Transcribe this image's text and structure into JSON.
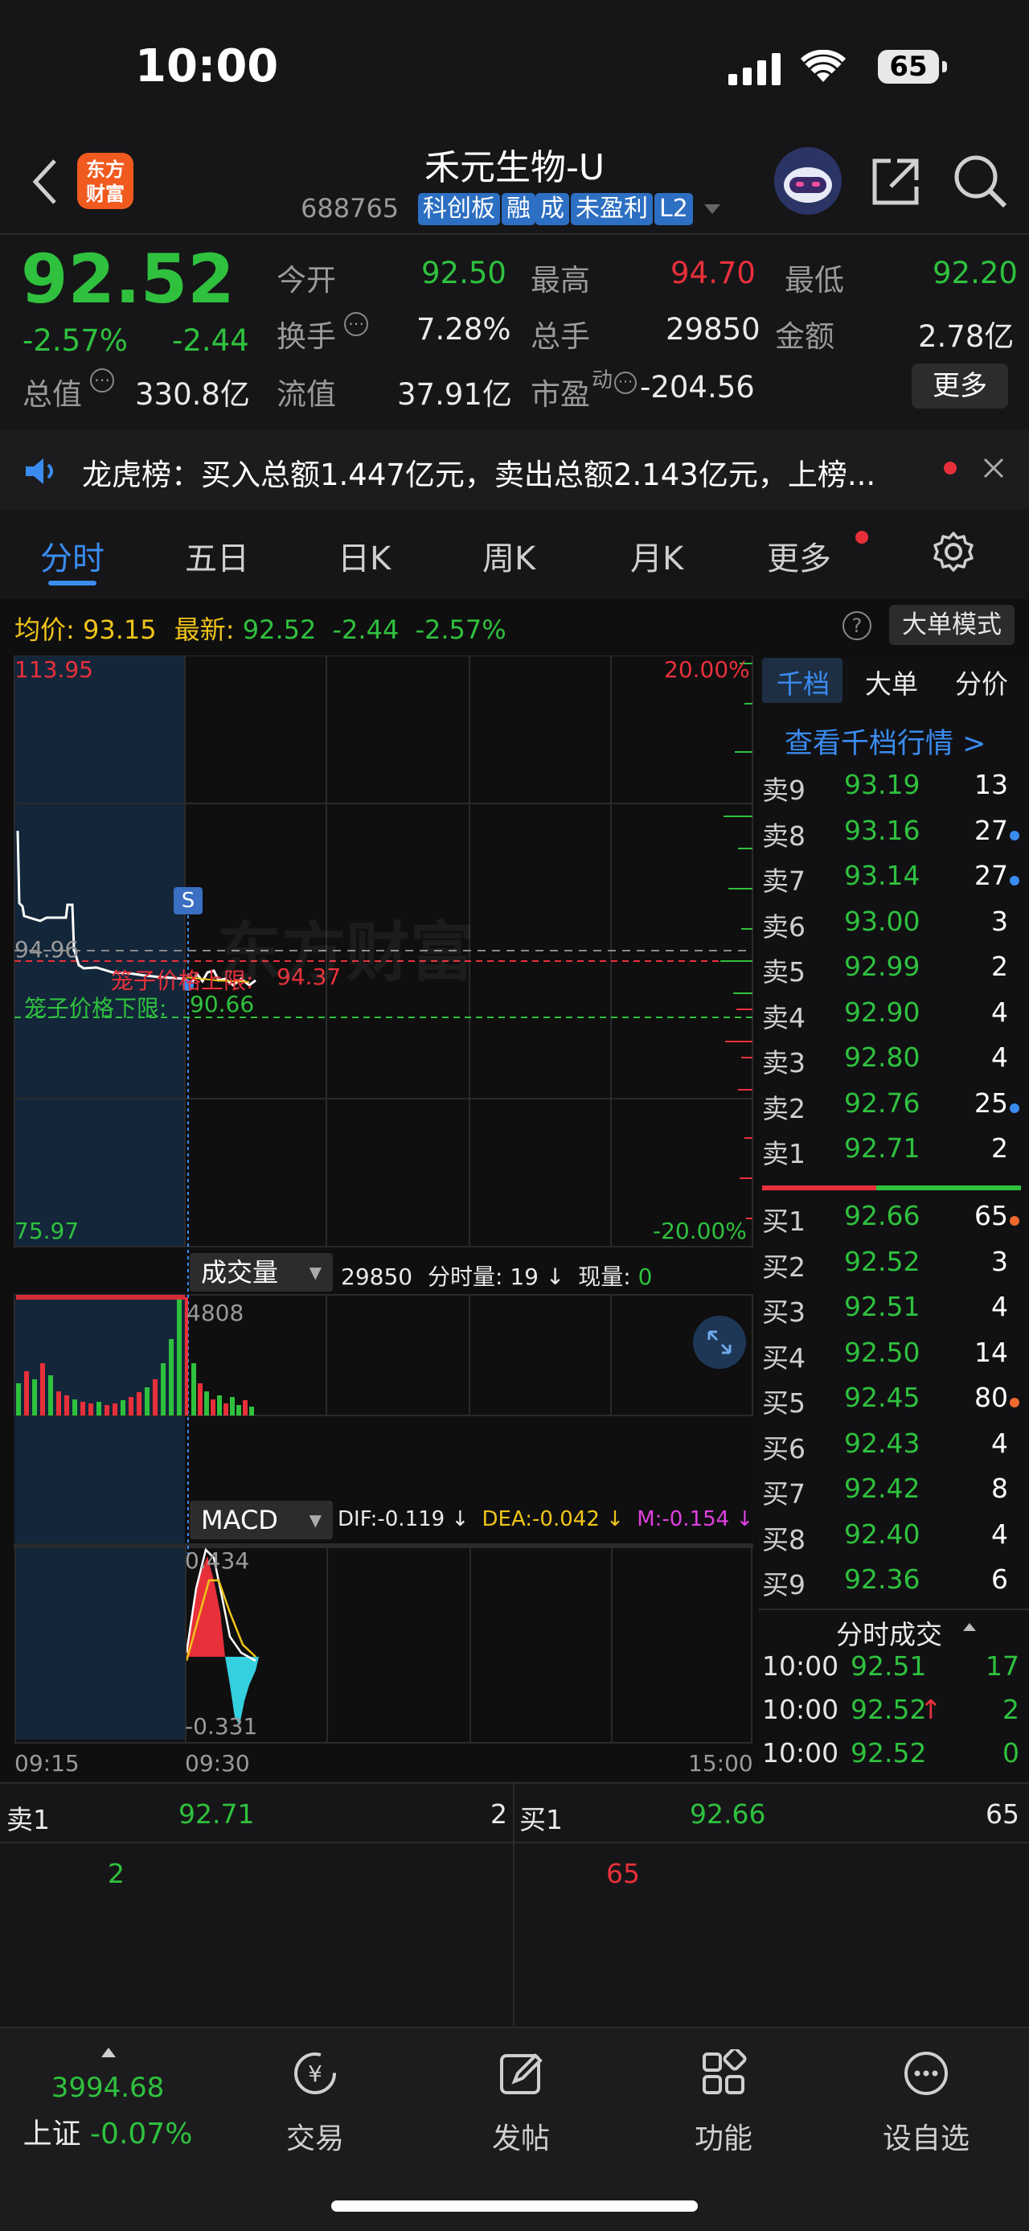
{
  "status": {
    "time": "10:00",
    "battery": "65"
  },
  "header": {
    "logo_text": "东方\n财富",
    "title": "禾元生物-U",
    "code": "688765",
    "tags": [
      "科创板",
      "融",
      "成",
      "未盈利",
      "L2"
    ]
  },
  "quote": {
    "price": "92.52",
    "change_pct": "-2.57%",
    "change": "-2.44",
    "open_label": "今开",
    "open": "92.50",
    "high_label": "最高",
    "high": "94.70",
    "low_label": "最低",
    "low": "92.20",
    "turnover_label": "换手",
    "turnover": "7.28%",
    "volume_label": "总手",
    "volume": "29850",
    "amount_label": "金额",
    "amount": "2.78亿",
    "mcap_label": "总值",
    "mcap": "330.8亿",
    "float_label": "流值",
    "float": "37.91亿",
    "pe_label": "市盈",
    "pe_sup": "动",
    "pe": "-204.56",
    "more": "更多"
  },
  "banner": {
    "text": "龙虎榜：买入总额1.447亿元，卖出总额2.143亿元，上榜..."
  },
  "tabs": [
    "分时",
    "五日",
    "日K",
    "周K",
    "月K",
    "更多"
  ],
  "summary": {
    "avg_label": "均价:",
    "avg": "93.15",
    "last_label": "最新:",
    "last": "92.52",
    "chg": "-2.44",
    "pct": "-2.57%",
    "mode_btn": "大单模式"
  },
  "chart": {
    "y_top": "113.95",
    "y_bottom": "75.97",
    "pct_top": "20.00%",
    "pct_bottom": "-20.00%",
    "prev_close": "94.96",
    "upper_label": "笼子价格上限:",
    "upper": "94.37",
    "lower_label": "笼子价格下限:",
    "lower": "90.66",
    "marker": "S",
    "watermark": "东方财富"
  },
  "volume_panel": {
    "selector": "成交量",
    "total": "29850",
    "minute_label": "分时量:",
    "minute": "19",
    "now_label": "现量:",
    "now": "0",
    "max": "4808"
  },
  "macd_panel": {
    "selector": "MACD",
    "dif": "DIF:-0.119 ↓",
    "dea": "DEA:-0.042 ↓",
    "m": "M:-0.154 ↓",
    "top": "0.434",
    "bottom": "-0.331"
  },
  "time_axis": [
    "09:15",
    "09:30",
    "15:00"
  ],
  "orderbook": {
    "tabs": [
      "千档",
      "大单",
      "分价"
    ],
    "link": "查看千档行情 >",
    "asks": [
      {
        "label": "卖9",
        "price": "93.19",
        "vol": "13",
        "dot": ""
      },
      {
        "label": "卖8",
        "price": "93.16",
        "vol": "27",
        "dot": "#3a8cf0"
      },
      {
        "label": "卖7",
        "price": "93.14",
        "vol": "27",
        "dot": "#3a8cf0"
      },
      {
        "label": "卖6",
        "price": "93.00",
        "vol": "3",
        "dot": ""
      },
      {
        "label": "卖5",
        "price": "92.99",
        "vol": "2",
        "dot": ""
      },
      {
        "label": "卖4",
        "price": "92.90",
        "vol": "4",
        "dot": ""
      },
      {
        "label": "卖3",
        "price": "92.80",
        "vol": "4",
        "dot": ""
      },
      {
        "label": "卖2",
        "price": "92.76",
        "vol": "25",
        "dot": "#3a8cf0"
      },
      {
        "label": "卖1",
        "price": "92.71",
        "vol": "2",
        "dot": ""
      }
    ],
    "bids": [
      {
        "label": "买1",
        "price": "92.66",
        "vol": "65",
        "dot": "#f06a30"
      },
      {
        "label": "买2",
        "price": "92.52",
        "vol": "3",
        "dot": ""
      },
      {
        "label": "买3",
        "price": "92.51",
        "vol": "4",
        "dot": ""
      },
      {
        "label": "买4",
        "price": "92.50",
        "vol": "14",
        "dot": ""
      },
      {
        "label": "买5",
        "price": "92.45",
        "vol": "80",
        "dot": "#f06a30"
      },
      {
        "label": "买6",
        "price": "92.43",
        "vol": "4",
        "dot": ""
      },
      {
        "label": "买7",
        "price": "92.42",
        "vol": "8",
        "dot": ""
      },
      {
        "label": "买8",
        "price": "92.40",
        "vol": "4",
        "dot": ""
      },
      {
        "label": "买9",
        "price": "92.36",
        "vol": "6",
        "dot": ""
      }
    ],
    "ticks_label": "分时成交",
    "ticks": [
      {
        "time": "10:00",
        "price": "92.51",
        "vol": "17",
        "arrow": ""
      },
      {
        "time": "10:00",
        "price": "92.52",
        "vol": "2",
        "arrow": "↑"
      },
      {
        "time": "10:00",
        "price": "92.52",
        "vol": "0",
        "arrow": ""
      }
    ]
  },
  "level1": {
    "ask_label": "卖1",
    "ask_price": "92.71",
    "ask_vol": "2",
    "ask_sub": "2",
    "bid_label": "买1",
    "bid_price": "92.66",
    "bid_vol": "65",
    "bid_sub": "65"
  },
  "bottom_nav": [
    {
      "label": "上证 -0.07%",
      "value": "3994.68"
    },
    {
      "label": "交易"
    },
    {
      "label": "发帖"
    },
    {
      "label": "功能"
    },
    {
      "label": "设自选"
    }
  ]
}
